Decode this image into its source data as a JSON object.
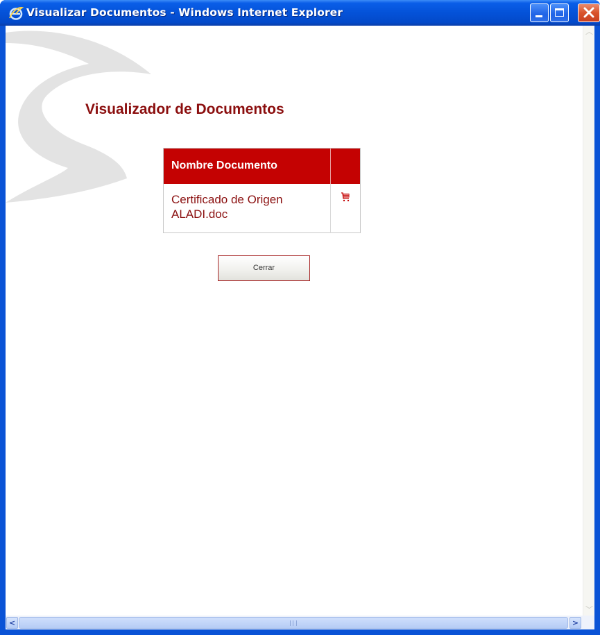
{
  "window": {
    "title": "Visualizar Documentos - Windows Internet Explorer",
    "title_icon": "ie-logo-icon",
    "controls": [
      "minimize-icon",
      "maximize-icon",
      "close-icon"
    ]
  },
  "page": {
    "heading": "Visualizador de Documentos",
    "table": {
      "header": "Nombre Documento",
      "rows": [
        {
          "name": "Certificado de Origen ALADI.doc",
          "action_icon": "cart-icon"
        }
      ]
    },
    "close_button_label": "Cerrar"
  },
  "colors": {
    "accent": "#c40202",
    "text_dark_red": "#8b0e0e",
    "titlebar_blue": "#0452d8"
  }
}
